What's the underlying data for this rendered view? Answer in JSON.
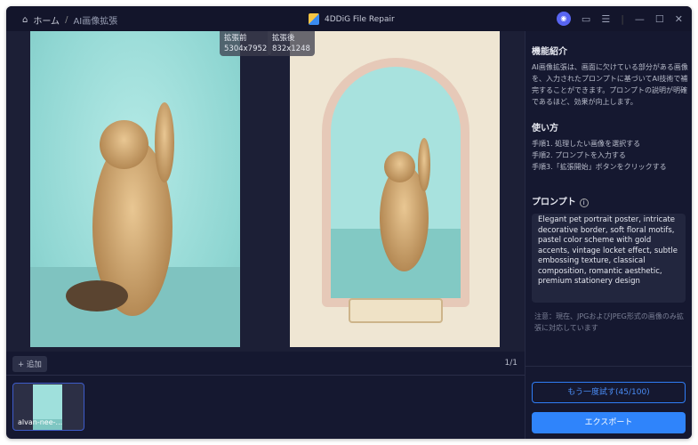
{
  "titlebar": {
    "home_label": "ホーム",
    "separator": "/",
    "current": "AI画像拡張",
    "app_title": "4DDiG File Repair",
    "icons": [
      "discord-icon",
      "feedback-icon",
      "menu-icon",
      "minimize-icon",
      "maximize-icon",
      "close-icon"
    ]
  },
  "preview": {
    "before_label": "拡張前",
    "before_size": "5304x7952",
    "after_label": "拡張後",
    "after_size": "832x1248"
  },
  "toolbar": {
    "add_label": "追加",
    "page": "1/1"
  },
  "thumbnails": [
    {
      "name": "alvan-nee-..."
    }
  ],
  "panel": {
    "intro_title": "機能紹介",
    "intro_text": "AI画像拡張は、画面に欠けている部分がある画像を、入力されたプロンプトに基づいてAI技術で補完することができます。プロンプトの説明が明確であるほど、効果が向上します。",
    "howto_title": "使い方",
    "steps": [
      "手順1. 処理したい画像を選択する",
      "手順2. プロンプトを入力する",
      "手順3.「拡張開始」ボタンをクリックする"
    ],
    "prompt_title": "プロンプト",
    "prompt_value": "Elegant pet portrait poster, intricate decorative border, soft floral motifs, pastel color scheme with gold accents, vintage locket effect, subtle embossing texture, classical composition, romantic aesthetic, premium stationery design",
    "note": "注意：現在、JPGおよびJPEG形式の画像のみ拡張に対応しています",
    "retry_label": "もう一度試す(45/100)",
    "export_label": "エクスポート"
  },
  "colors": {
    "accent": "#2f84fb",
    "background": "#151830"
  }
}
